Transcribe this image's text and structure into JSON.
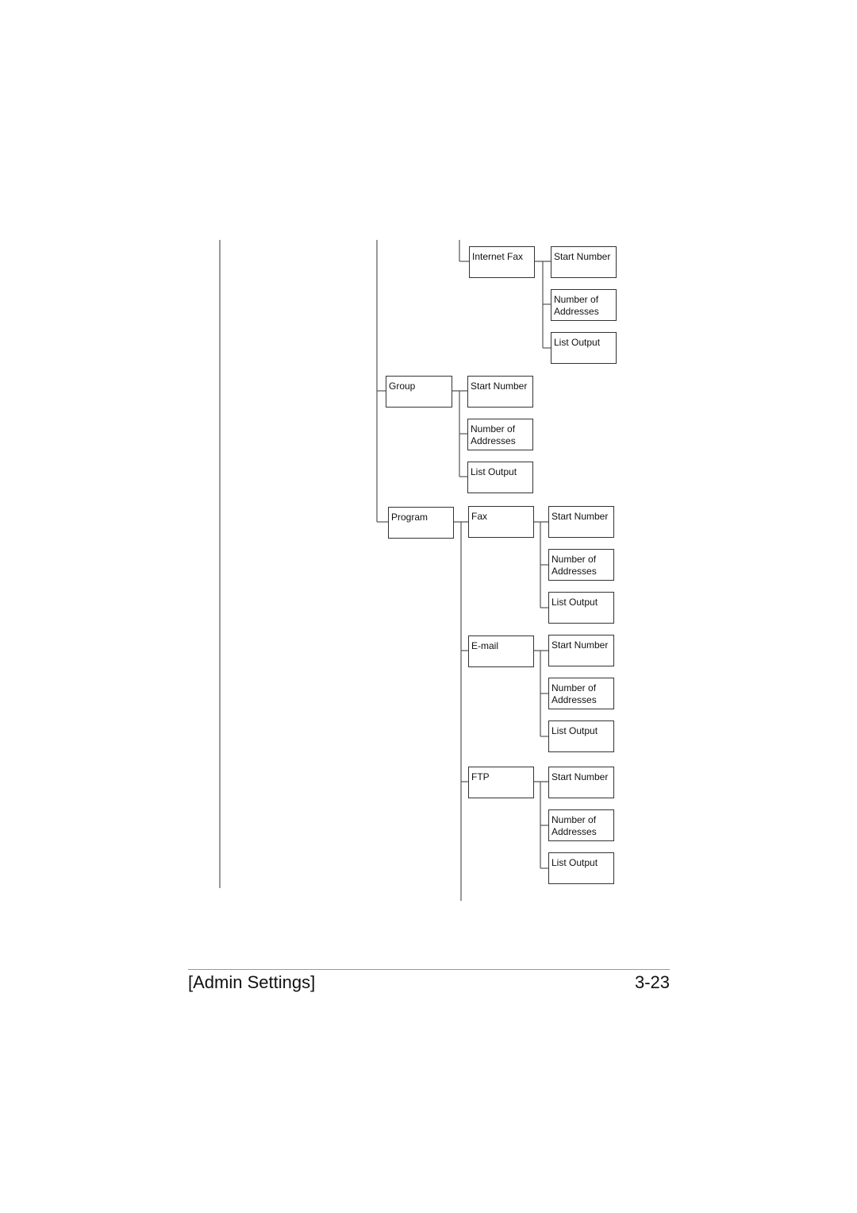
{
  "diagram": {
    "nodes": {
      "internet_fax": "Internet Fax",
      "internet_fax_start": "Start Number",
      "internet_fax_number": "Number of\nAddresses",
      "internet_fax_list": "List Output",
      "group": "Group",
      "group_start": "Start Number",
      "group_number": "Number of\nAddresses",
      "group_list": "List Output",
      "program": "Program",
      "fax": "Fax",
      "fax_start": "Start Number",
      "fax_number": "Number of\nAddresses",
      "fax_list": "List Output",
      "email": "E-mail",
      "email_start": "Start Number",
      "email_number": "Number of\nAddresses",
      "email_list": "List Output",
      "ftp": "FTP",
      "ftp_start": "Start Number",
      "ftp_number": "Number of\nAddresses",
      "ftp_list": "List Output"
    }
  },
  "footer": {
    "section": "[Admin Settings]",
    "page_number": "3-23"
  }
}
